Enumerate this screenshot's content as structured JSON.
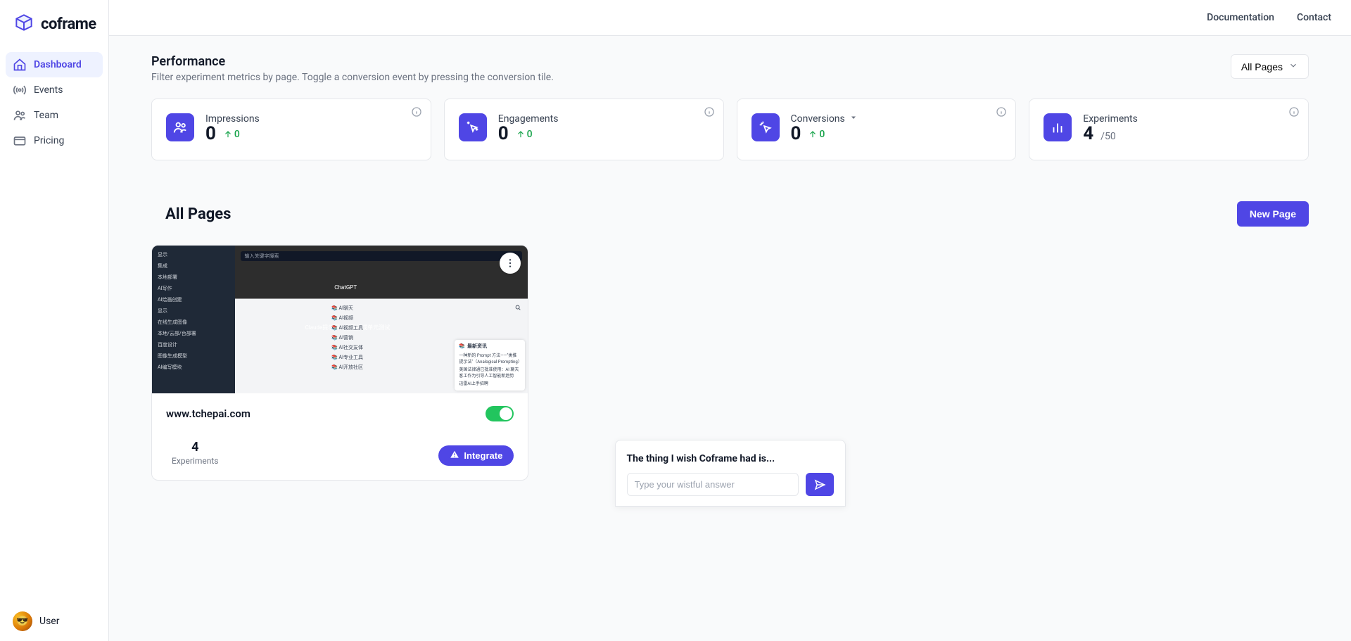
{
  "brand": {
    "name": "coframe"
  },
  "nav": {
    "items": [
      {
        "label": "Dashboard",
        "active": true
      },
      {
        "label": "Events"
      },
      {
        "label": "Team"
      },
      {
        "label": "Pricing"
      }
    ]
  },
  "user": {
    "name": "User"
  },
  "header": {
    "links": [
      {
        "label": "Documentation"
      },
      {
        "label": "Contact"
      }
    ]
  },
  "performance": {
    "title": "Performance",
    "subtitle": "Filter experiment metrics by page. Toggle a conversion event by pressing the conversion tile.",
    "filter_label": "All Pages",
    "stats": [
      {
        "key": "impressions",
        "label": "Impressions",
        "value": "0",
        "delta": "0"
      },
      {
        "key": "engagements",
        "label": "Engagements",
        "value": "0",
        "delta": "0"
      },
      {
        "key": "conversions",
        "label": "Conversions",
        "value": "0",
        "delta": "0",
        "has_dropdown": true
      },
      {
        "key": "experiments",
        "label": "Experiments",
        "value": "4",
        "suffix": "/50"
      }
    ]
  },
  "pages": {
    "title": "All Pages",
    "new_button": "New Page",
    "items": [
      {
        "url": "www.tchepai.com",
        "enabled": true,
        "experiments": "4",
        "experiments_label": "Experiments",
        "integrate_label": "Integrate",
        "thumb": {
          "search_placeholder": "输入关键字搜索",
          "caption_top": "ChatGPT",
          "caption": "Claude提示词：代码生成单元测试",
          "side_items": [
            "显示",
            "集成",
            "本地部署",
            "AI写作",
            "AI绘画创建",
            "显示",
            "在线生成图像",
            "本地/云部/台部署",
            "百度设计",
            "图像生成模型",
            "AI编写模块"
          ],
          "tag_items": [
            "AI聊天",
            "AI视频",
            "AI视频工具",
            "AI营销",
            "AI社交友体",
            "AI专业工具",
            "AI开放社区"
          ],
          "news_title": "最新资讯",
          "news_items": [
            "一种新的 Prompt 方法——\"类推提示法\"（Analogical Prompting）",
            "美国法律通已批准使用：AI 聊天客工作为引导人工智能新趋势",
            "迅雷AI上手招聘"
          ]
        }
      }
    ]
  },
  "feedback": {
    "title": "The thing I wish Coframe had is...",
    "placeholder": "Type your wistful answer"
  }
}
